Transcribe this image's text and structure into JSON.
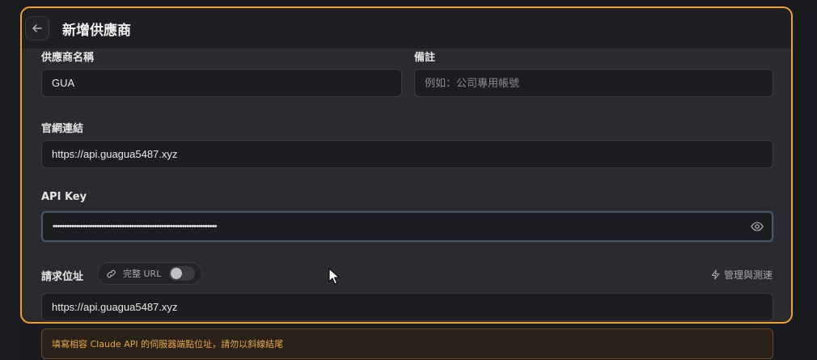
{
  "header": {
    "title": "新增供應商"
  },
  "fields": {
    "provider_name": {
      "label": "供應商名稱",
      "value": "GUA"
    },
    "note": {
      "label": "備註",
      "placeholder": "例如：公司專用帳號"
    },
    "website": {
      "label": "官網連結",
      "value": "https://api.guagua5487.xyz"
    },
    "api_key": {
      "label": "API Key",
      "value": "•••••••••••••••••••••••••••••••••••••••••••••••••••••••••••••••••••••••"
    },
    "request_url": {
      "label": "請求位址",
      "toggle_label": "完整 URL",
      "toggle_on": false,
      "manage_label": "管理與測速",
      "value": "https://api.guagua5487.xyz"
    }
  },
  "warning": {
    "text": "填寫相容 Claude API 的伺服器端點位址，請勿以斜線結尾"
  },
  "colors": {
    "accent_border": "#f0a030",
    "warning_text": "#e6a94a"
  }
}
